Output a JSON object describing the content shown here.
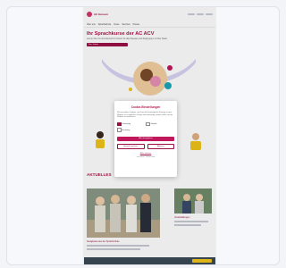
{
  "site": {
    "logo_text": "AC Hessen",
    "nav": [
      "Über uns",
      "Sprachschule",
      "Kurse",
      "Services",
      "Presse",
      "Kontakt"
    ]
  },
  "hero": {
    "title": "Ihr Sprachkurse der AC ACV",
    "subtitle": "Lernen Sie mit uns Deutsch in Kursen für alle Niveaus und Zielgruppen in Ihrer Stadt.",
    "button": "Kurs finden"
  },
  "news": {
    "section_title": "AKTUELLES",
    "caption_main": "Neuigkeiten aus der Sprachschule",
    "caption_side": "Veranstaltungen"
  },
  "cookie": {
    "title": "Cookie-Einstellungen",
    "text": "Wir verwenden Cookies, um Ihnen die bestmögliche Nutzung unserer Website zu ermöglichen. Einige sind notwendig, andere helfen uns die Website zu verbessern.",
    "options": [
      {
        "label": "Notwendig",
        "checked": true
      },
      {
        "label": "Statistik",
        "checked": false
      },
      {
        "label": "Marketing",
        "checked": false
      }
    ],
    "accept_label": "Alle akzeptieren",
    "save_label": "Auswahl speichern",
    "reject_label": "Ablehnen",
    "details_link": "Mehr erfahren",
    "footer": "Impressum · Datenschutz"
  },
  "colors": {
    "brand": "#b0164f",
    "accent": "#c1185c",
    "footer_button": "#f0c419"
  }
}
